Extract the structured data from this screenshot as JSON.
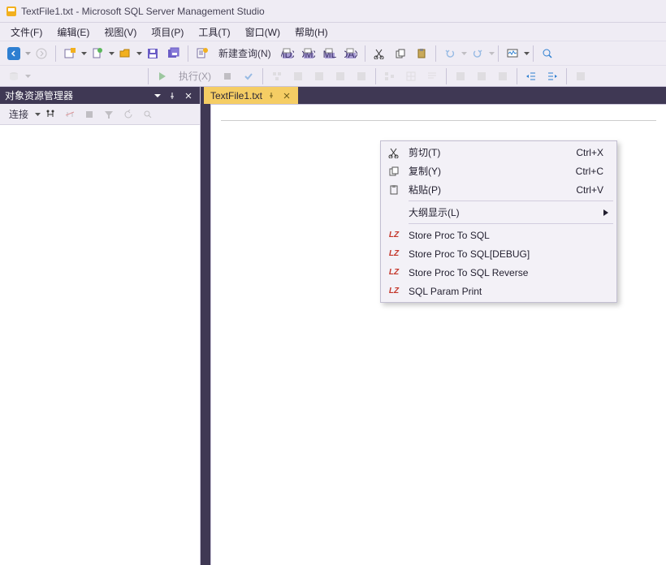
{
  "title": "TextFile1.txt - Microsoft SQL Server Management Studio",
  "menu": {
    "file": "文件(F)",
    "edit": "编辑(E)",
    "view": "视图(V)",
    "project": "项目(P)",
    "tools": "工具(T)",
    "window": "窗口(W)",
    "help": "帮助(H)"
  },
  "toolbar": {
    "new_query": "新建查询(N)",
    "execute": "执行(X)"
  },
  "sidebar": {
    "title": "对象资源管理器",
    "connect": "连接"
  },
  "tab": {
    "name": "TextFile1.txt"
  },
  "context_menu": {
    "cut": {
      "label": "剪切(T)",
      "shortcut": "Ctrl+X"
    },
    "copy": {
      "label": "复制(Y)",
      "shortcut": "Ctrl+C"
    },
    "paste": {
      "label": "粘贴(P)",
      "shortcut": "Ctrl+V"
    },
    "outline": {
      "label": "大纲显示(L)"
    },
    "sp_sql": "Store Proc To SQL",
    "sp_sql_debug": "Store Proc To SQL[DEBUG]",
    "sp_sql_reverse": "Store Proc To SQL Reverse",
    "sql_param": "SQL Param Print"
  }
}
